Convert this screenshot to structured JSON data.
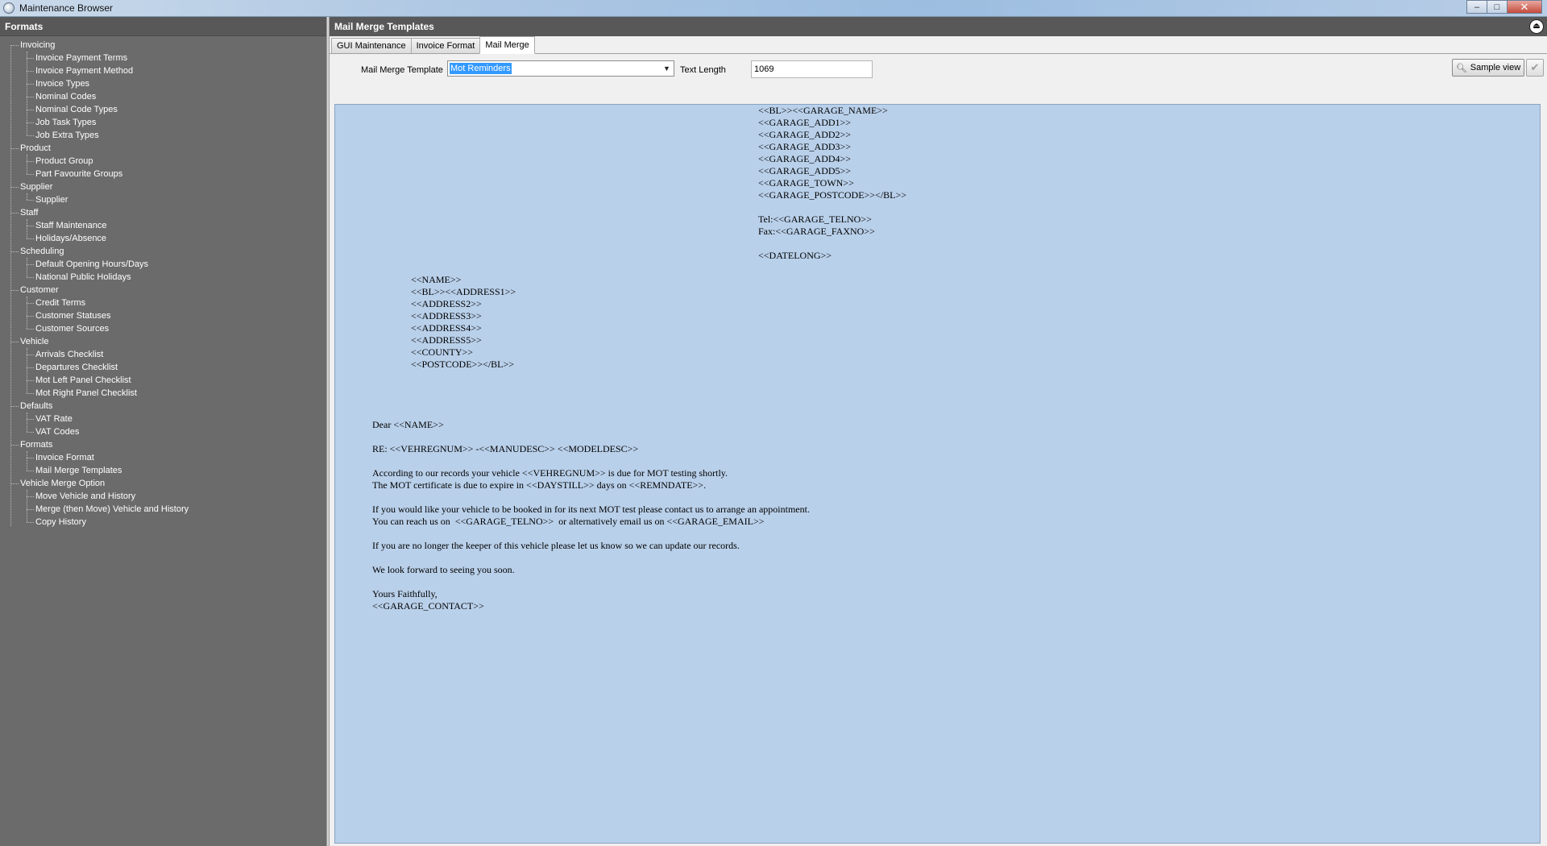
{
  "window": {
    "title": "Maintenance Browser",
    "controls": {
      "minimize": "–",
      "maximize": "□",
      "close": "✕"
    }
  },
  "sidebar": {
    "title": "Formats",
    "groups": [
      {
        "label": "Invoicing",
        "items": [
          "Invoice Payment Terms",
          "Invoice Payment Method",
          "Invoice Types",
          "Nominal Codes",
          "Nominal Code Types",
          "Job Task Types",
          "Job Extra Types"
        ]
      },
      {
        "label": "Product",
        "items": [
          "Product Group",
          "Part Favourite Groups"
        ]
      },
      {
        "label": "Supplier",
        "items": [
          "Supplier"
        ]
      },
      {
        "label": "Staff",
        "items": [
          "Staff Maintenance",
          "Holidays/Absence"
        ]
      },
      {
        "label": "Scheduling",
        "items": [
          "Default Opening Hours/Days",
          "National Public Holidays"
        ]
      },
      {
        "label": "Customer",
        "items": [
          "Credit Terms",
          "Customer Statuses",
          "Customer Sources"
        ]
      },
      {
        "label": "Vehicle",
        "items": [
          "Arrivals Checklist",
          "Departures Checklist",
          "Mot Left Panel Checklist",
          "Mot Right Panel Checklist"
        ]
      },
      {
        "label": "Defaults",
        "items": [
          "VAT Rate",
          "VAT Codes"
        ]
      },
      {
        "label": "Formats",
        "items": [
          "Invoice Format",
          "Mail Merge Templates"
        ]
      },
      {
        "label": "Vehicle Merge Option",
        "items": [
          "Move Vehicle and History",
          "Merge (then Move) Vehicle and History",
          "Copy History"
        ]
      }
    ]
  },
  "main": {
    "title": "Mail Merge Templates",
    "tabs": [
      {
        "label": "GUI Maintenance",
        "active": false
      },
      {
        "label": "Invoice Format",
        "active": false
      },
      {
        "label": "Mail Merge",
        "active": true
      }
    ],
    "toolbar": {
      "template_label": "Mail Merge Template",
      "template_value": "Mot Reminders",
      "text_length_label": "Text Length",
      "text_length_value": "1069",
      "sample_view_label": "Sample view",
      "confirm_icon": "✔"
    },
    "document": {
      "garage_block": [
        "<<BL>><<GARAGE_NAME>>",
        "<<GARAGE_ADD1>>",
        "<<GARAGE_ADD2>>",
        "<<GARAGE_ADD3>>",
        "<<GARAGE_ADD4>>",
        "<<GARAGE_ADD5>>",
        "<<GARAGE_TOWN>>",
        "<<GARAGE_POSTCODE>></BL>>",
        "",
        "Tel:<<GARAGE_TELNO>>",
        "Fax:<<GARAGE_FAXNO>>",
        "",
        "<<DATELONG>>"
      ],
      "address_block": [
        "<<NAME>>",
        "<<BL>><<ADDRESS1>>",
        "<<ADDRESS2>>",
        "<<ADDRESS3>>",
        "<<ADDRESS4>>",
        "<<ADDRESS5>>",
        "<<COUNTY>>",
        "<<POSTCODE>></BL>>"
      ],
      "body_block": [
        "Dear <<NAME>>",
        "",
        "RE: <<VEHREGNUM>> -<<MANUDESC>> <<MODELDESC>>",
        "",
        "According to our records your vehicle <<VEHREGNUM>> is due for MOT testing shortly.",
        "The MOT certificate is due to expire in <<DAYSTILL>> days on <<REMNDATE>>.",
        "",
        "If you would like your vehicle to be booked in for its next MOT test please contact us to arrange an appointment.",
        "You can reach us on  <<GARAGE_TELNO>>  or alternatively email us on <<GARAGE_EMAIL>>",
        "",
        "If you are no longer the keeper of this vehicle please let us know so we can update our records.",
        "",
        "We look forward to seeing you soon.",
        "",
        "Yours Faithfully,",
        "<<GARAGE_CONTACT>>"
      ]
    }
  },
  "colors": {
    "panel_bg": "#6b6b6b",
    "header_bg": "#585858",
    "document_bg": "#b9d0ea",
    "selection": "#3399ff"
  }
}
